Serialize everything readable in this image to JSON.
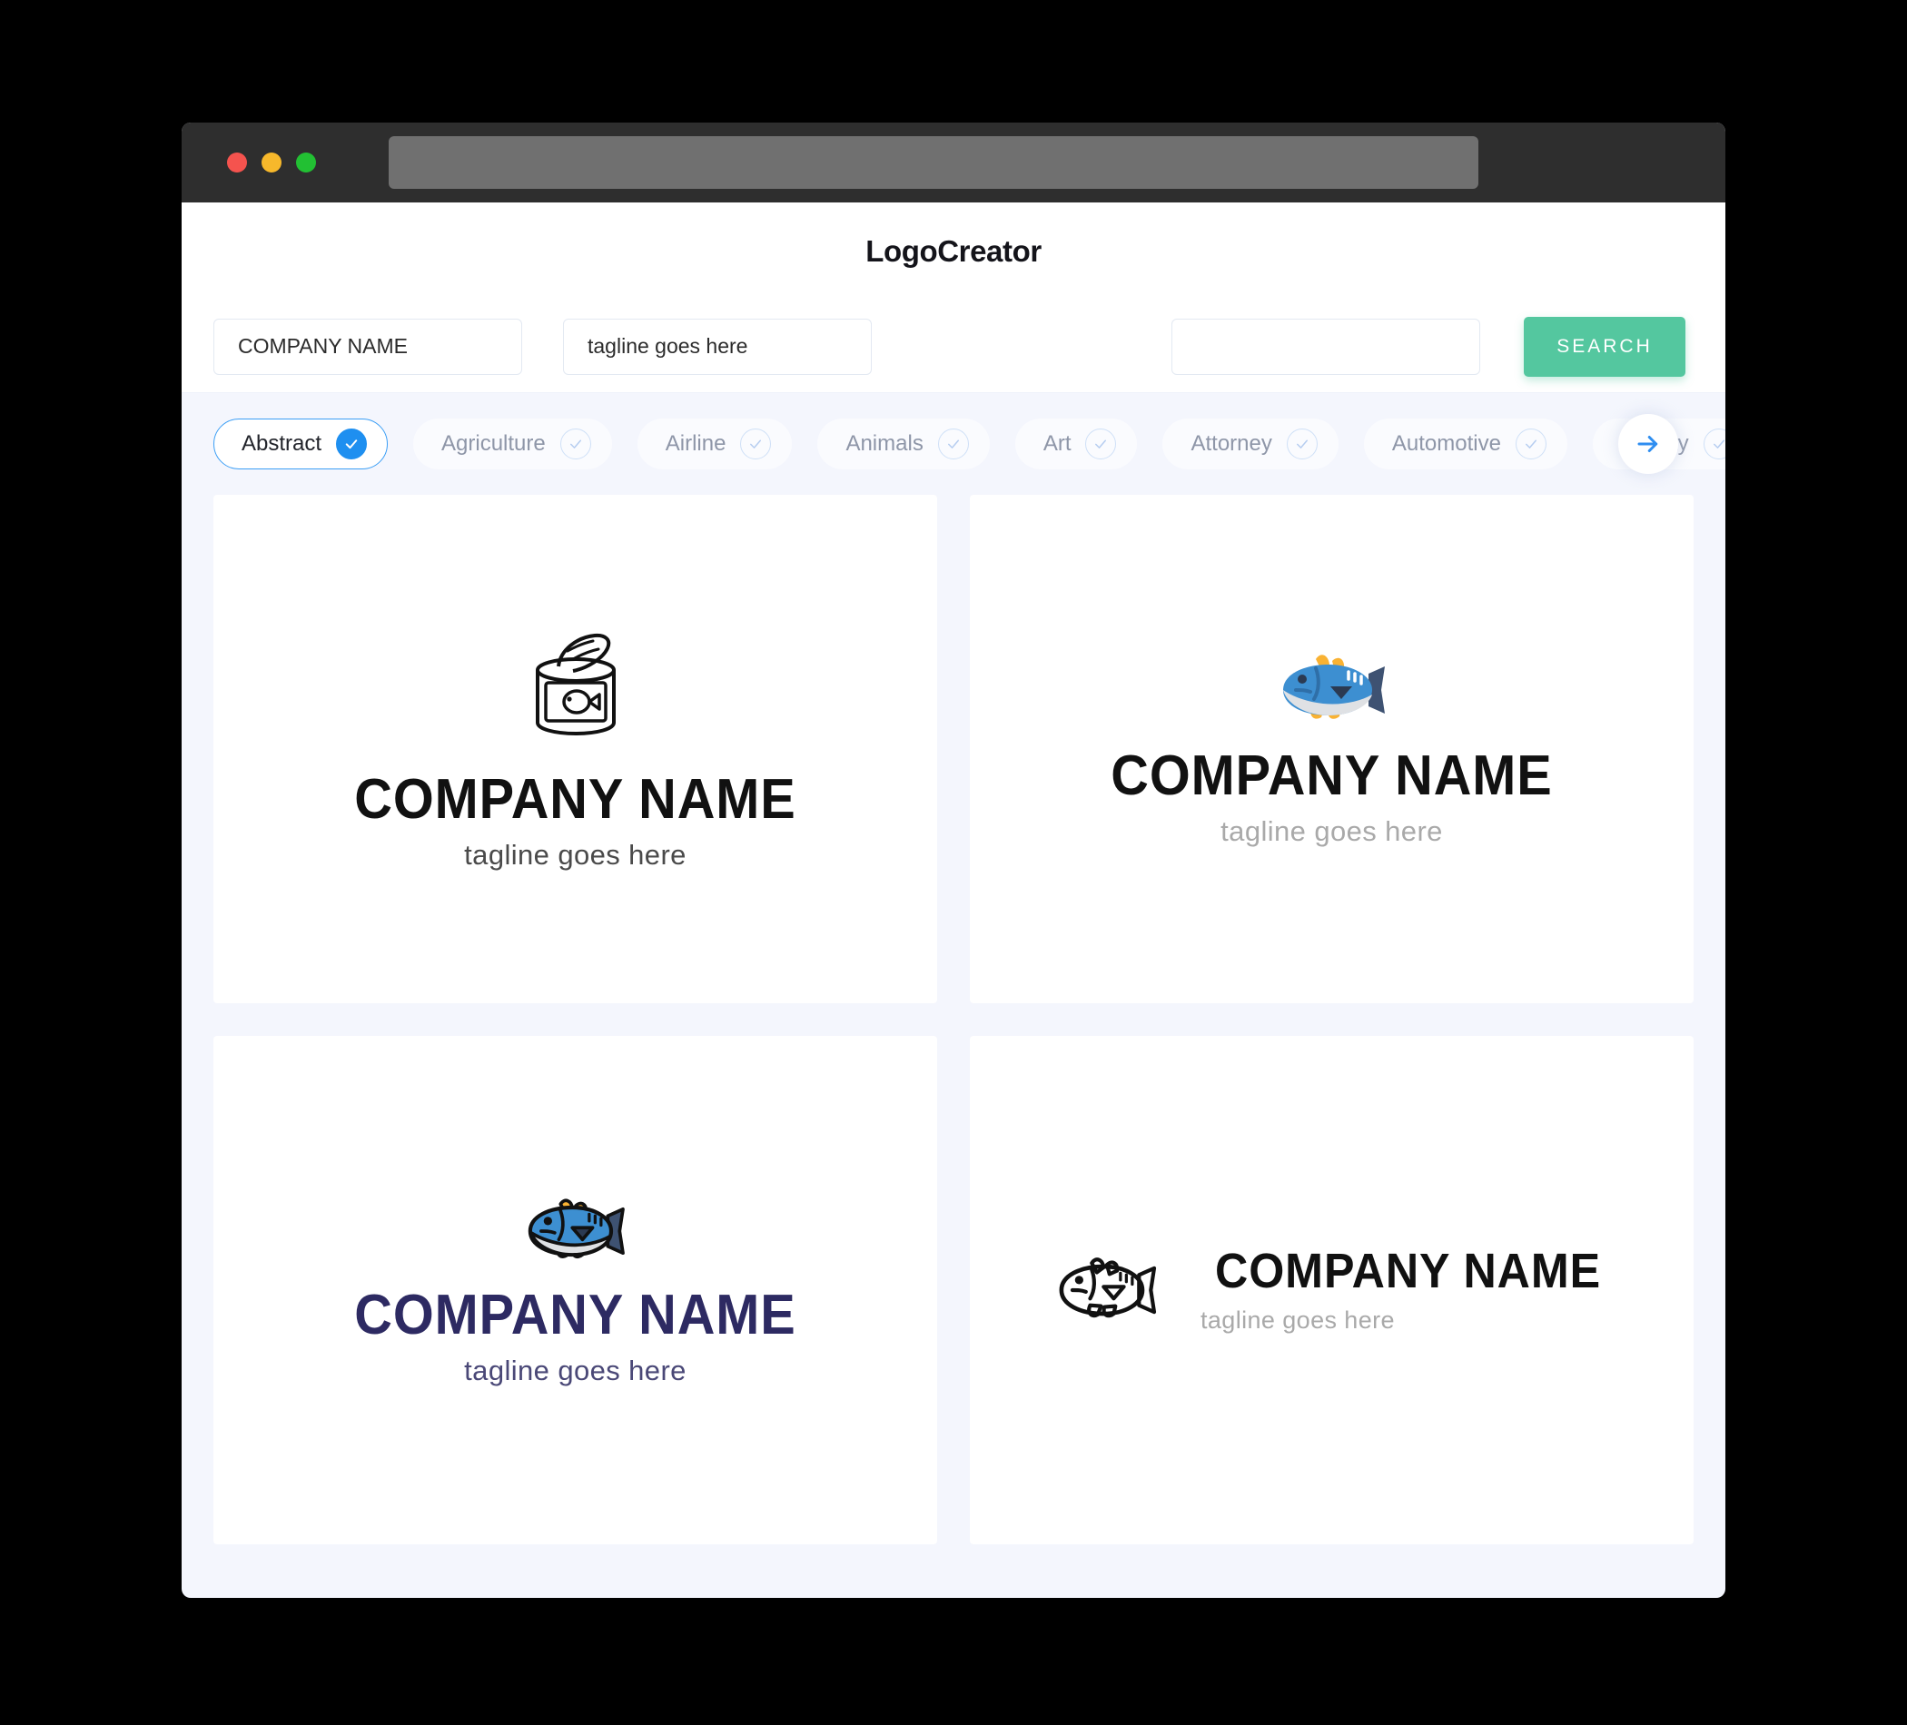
{
  "browser": {
    "traffic_lights": [
      "close-red",
      "minimize-yellow",
      "maximize-green"
    ],
    "url_value": ""
  },
  "header": {
    "title": "LogoCreator"
  },
  "search": {
    "company_value": "COMPANY NAME",
    "company_placeholder": "COMPANY NAME",
    "tagline_value": "tagline goes here",
    "tagline_placeholder": "tagline goes here",
    "keyword_value": "",
    "keyword_placeholder": "",
    "button_label": "SEARCH",
    "button_color": "#54c79f"
  },
  "categories": {
    "selected": "Abstract",
    "accent_color": "#1e8ff0",
    "items": [
      {
        "label": "Abstract",
        "selected": true
      },
      {
        "label": "Agriculture",
        "selected": false
      },
      {
        "label": "Airline",
        "selected": false
      },
      {
        "label": "Animals",
        "selected": false
      },
      {
        "label": "Art",
        "selected": false
      },
      {
        "label": "Attorney",
        "selected": false
      },
      {
        "label": "Automotive",
        "selected": false
      },
      {
        "label": "Beauty",
        "selected": false
      }
    ],
    "next_icon": "arrow-right-icon"
  },
  "results": [
    {
      "icon": "tin-can-with-fish-icon",
      "layout": "stacked",
      "name": "COMPANY NAME",
      "tagline": "tagline goes here",
      "name_color": "#111111",
      "tagline_color": "#4a4a4a"
    },
    {
      "icon": "flat-tuna-fish-icon",
      "layout": "stacked",
      "name": "COMPANY NAME",
      "tagline": "tagline goes here",
      "name_color": "#111111",
      "tagline_color": "#a9a9a9"
    },
    {
      "icon": "outlined-tuna-fish-icon",
      "layout": "stacked",
      "name": "COMPANY NAME",
      "tagline": "tagline goes here",
      "name_color": "#2d2a62",
      "tagline_color": "#4a4877"
    },
    {
      "icon": "line-art-fish-icon",
      "layout": "horizontal",
      "name": "COMPANY NAME",
      "tagline": "tagline goes here",
      "name_color": "#111111",
      "tagline_color": "#a9a9a9"
    }
  ]
}
